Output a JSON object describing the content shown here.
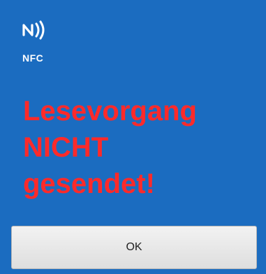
{
  "app": {
    "logo_icon": "nfc-icon",
    "logo_text": "NFC"
  },
  "message": {
    "lines": [
      "Lesevorgang",
      "NICHT",
      "gesendet!"
    ]
  },
  "button": {
    "ok_label": "OK"
  },
  "colors": {
    "background": "#1b6cc0",
    "message_text": "#ff2a2a",
    "button_bg": "#e8e8e8"
  }
}
